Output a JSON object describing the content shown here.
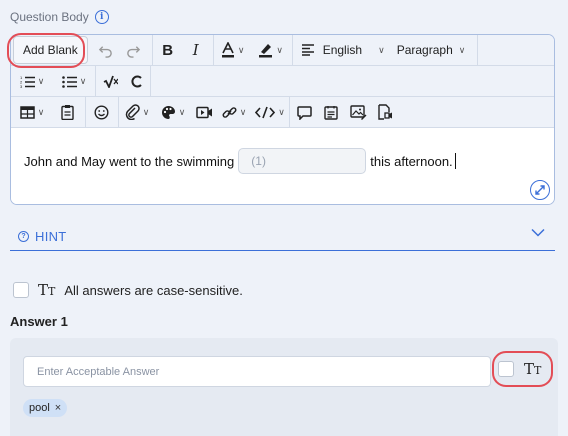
{
  "question_body": {
    "label": "Question Body",
    "info_icon": "i"
  },
  "toolbar": {
    "add_blank_label": "Add Blank",
    "language_label": "English",
    "block_format_label": "Paragraph"
  },
  "editor": {
    "text_before": "John and May went to the swimming",
    "blank_placeholder": "(1)",
    "text_after": "this afternoon."
  },
  "hint": {
    "label": "HINT",
    "icon": "?"
  },
  "case_sensitivity": {
    "label": "All answers are case-sensitive."
  },
  "answer": {
    "title": "Answer 1",
    "input_placeholder": "Enter Acceptable Answer",
    "chips": [
      "pool"
    ]
  },
  "colors": {
    "accent": "#3b6fd8",
    "highlight_ring": "#e34d56",
    "chip_bg": "#cfe0f6"
  }
}
